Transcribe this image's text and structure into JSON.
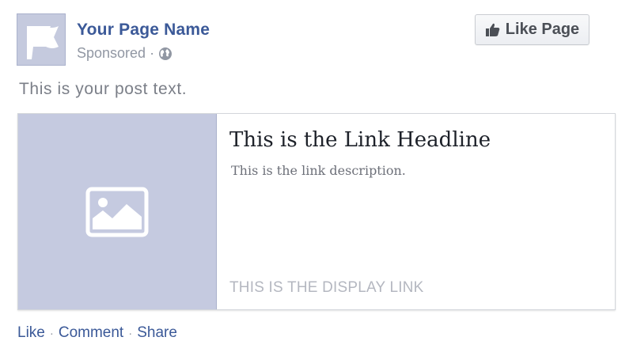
{
  "post": {
    "page_name": "Your Page Name",
    "sponsored_label": "Sponsored",
    "separator": "·",
    "text": "This is your post text.",
    "like_page_label": "Like Page"
  },
  "link": {
    "headline": "This is the Link Headline",
    "description": "This is the link description.",
    "display_link": "THIS IS THE DISPLAY LINK"
  },
  "actions": {
    "like": "Like",
    "comment": "Comment",
    "share": "Share",
    "separator": "·"
  },
  "icons": {
    "avatar": "flag-icon",
    "privacy": "globe-icon",
    "like_button": "thumbs-up-icon",
    "link_image": "image-placeholder-icon"
  },
  "colors": {
    "brand_blue": "#3b5998",
    "placeholder_bg": "#c5cae0",
    "muted_text": "#9197a3"
  }
}
